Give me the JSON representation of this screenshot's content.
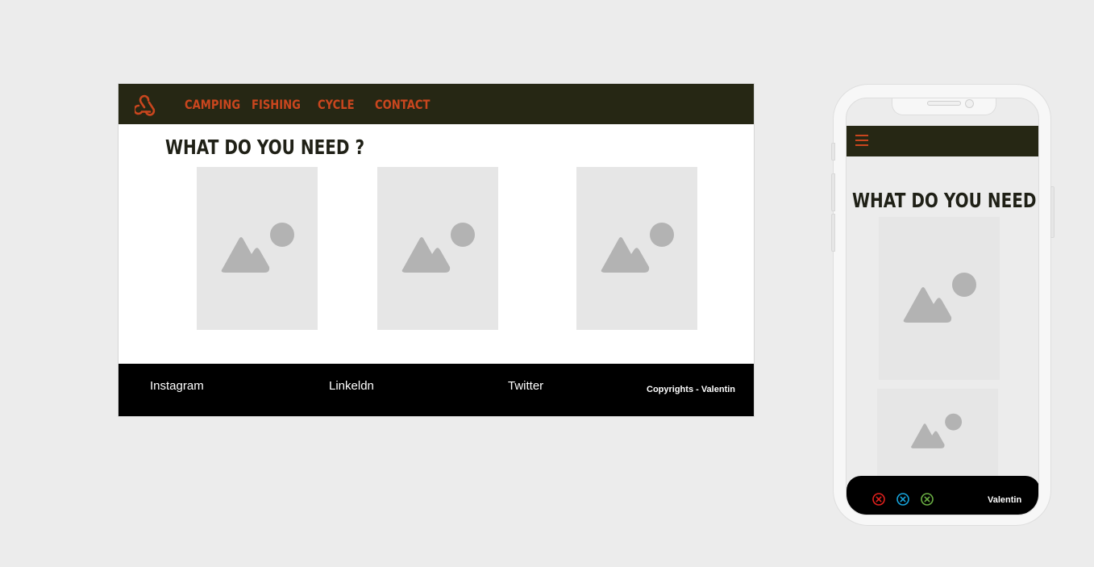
{
  "colors": {
    "nav_bg": "#262714",
    "accent": "#c9461e",
    "footer_bg": "#000000",
    "placeholder_bg": "#e6e6e6",
    "placeholder_icon": "#b3b3b3"
  },
  "desktop": {
    "logo_icon": "webhook-logo-icon",
    "nav": [
      "CAMPING",
      "FISHING",
      "CYCLE",
      "CONTACT"
    ],
    "heading": "WHAT DO YOU NEED ?",
    "cards": [
      "image-placeholder",
      "image-placeholder",
      "image-placeholder"
    ],
    "footer": {
      "links": [
        "Instagram",
        "Linkeldn",
        "Twitter"
      ],
      "copyright": "Copyrights -  Valentin"
    }
  },
  "mobile": {
    "menu_icon": "hamburger-menu-icon",
    "heading": "WHAT DO YOU NEED ?",
    "footer": {
      "icons": [
        {
          "name": "close-circle-icon",
          "color": "#e0201c"
        },
        {
          "name": "close-circle-icon",
          "color": "#16a3db"
        },
        {
          "name": "close-circle-icon",
          "color": "#6aae43"
        }
      ],
      "name": "Valentin"
    }
  }
}
